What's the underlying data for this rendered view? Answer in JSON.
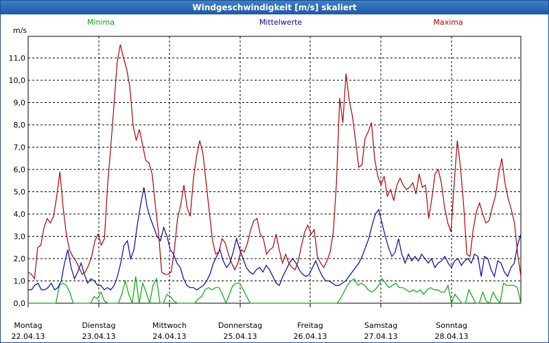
{
  "window": {
    "title": "Windgeschwindigkeit [m/s] skaliert"
  },
  "chart_data": {
    "type": "line",
    "title": "Windgeschwindigkeit [m/s] skaliert",
    "ylabel": "m/s",
    "ylim": [
      0,
      12
    ],
    "y_ticks": [
      "0,0",
      "1,0",
      "2,0",
      "3,0",
      "4,0",
      "5,0",
      "6,0",
      "7,0",
      "8,0",
      "9,0",
      "10,0",
      "11,0"
    ],
    "grid": true,
    "legend_position": "top",
    "days": [
      {
        "name": "Montag",
        "date": "22.04.13"
      },
      {
        "name": "Dienstag",
        "date": "23.04.13"
      },
      {
        "name": "Mittwoch",
        "date": "24.04.13"
      },
      {
        "name": "Donnerstag",
        "date": "25.04.13"
      },
      {
        "name": "Freitag",
        "date": "26.04.13"
      },
      {
        "name": "Samstag",
        "date": "27.04.13"
      },
      {
        "name": "Sonntag",
        "date": "28.04.13"
      }
    ],
    "series": [
      {
        "name": "Minima",
        "color": "#00aa00",
        "values": [
          0,
          0,
          0,
          0,
          0,
          0,
          0,
          0,
          0,
          0.8,
          0.9,
          0.8,
          0.5,
          0,
          0,
          0,
          0,
          0,
          0,
          0.3,
          0.2,
          0.5,
          0.1,
          0,
          0,
          0,
          0,
          0.4,
          1,
          0.4,
          0,
          1.2,
          0,
          0.9,
          0.5,
          0,
          0.8,
          1.1,
          0,
          0,
          0.4,
          0.3,
          0.1,
          0,
          0,
          0,
          0,
          0,
          0,
          0.2,
          0.3,
          0.6,
          0.7,
          0.6,
          0.7,
          0.7,
          0.4,
          0,
          0.4,
          0.8,
          0.9,
          0.9,
          0.6,
          0.3,
          0,
          0,
          0,
          0,
          0,
          0,
          0,
          0,
          0,
          0,
          0,
          0,
          0,
          0,
          0,
          0,
          0,
          0,
          0,
          0,
          0,
          0,
          0,
          0,
          0,
          0,
          0.2,
          0.5,
          0.8,
          1,
          1.1,
          0.8,
          0.9,
          0.8,
          0.6,
          0.5,
          0.6,
          0.8,
          1.1,
          0.9,
          0.7,
          0.8,
          0.9,
          0.7,
          0.7,
          0.6,
          0.5,
          0.6,
          0.5,
          0.6,
          0.4,
          0.6,
          0.7,
          0.6,
          0.6,
          0.5,
          0.5,
          0.8,
          0,
          0.4,
          0.2,
          0,
          0,
          0.6,
          0.3,
          0,
          0,
          0.5,
          0.1,
          0,
          0.5,
          0.2,
          0,
          0.9,
          0.8,
          0.8,
          0.8,
          0.7,
          0
        ]
      },
      {
        "name": "Mittelwerte",
        "color": "#0000aa",
        "values": [
          0.6,
          0.6,
          0.8,
          0.9,
          0.6,
          0.6,
          0.7,
          0.9,
          0.6,
          0.7,
          1,
          1.8,
          2.4,
          1.6,
          1.1,
          1.4,
          1.8,
          1.3,
          0.9,
          1.1,
          1,
          0.8,
          0.8,
          0.6,
          0.7,
          0.6,
          0.8,
          1.2,
          1.8,
          2.6,
          2.8,
          2,
          2.4,
          3.5,
          4.4,
          5.2,
          4.3,
          3.8,
          3.4,
          3,
          2.8,
          3.4,
          3,
          2.4,
          2.2,
          1.8,
          1.6,
          1.1,
          0.8,
          0.7,
          0.7,
          0.6,
          0.7,
          0.8,
          1,
          1.3,
          1.8,
          2.1,
          2.4,
          1.9,
          1.6,
          1.8,
          2.3,
          2.9,
          2.4,
          2,
          1.6,
          1.4,
          1.3,
          1.5,
          1.6,
          1.4,
          1.7,
          1.5,
          1.2,
          0.9,
          0.8,
          1.2,
          1.5,
          1.8,
          2,
          1.8,
          1.5,
          1.3,
          1.2,
          1.3,
          1.6,
          1.9,
          1.5,
          1.2,
          1,
          1,
          0.9,
          0.8,
          0.8,
          0.9,
          1,
          1.2,
          1.4,
          1.6,
          1.8,
          2.1,
          2.5,
          2.9,
          3.5,
          4,
          4.2,
          3.6,
          3,
          2.5,
          2.1,
          2.3,
          2.9,
          2.2,
          1.8,
          2.2,
          1.9,
          2.1,
          1.9,
          2.2,
          2,
          1.8,
          2,
          1.6,
          1.8,
          1.9,
          2.1,
          1.8,
          1.6,
          1.9,
          2,
          1.7,
          1.9,
          2,
          1.8,
          2.2,
          2.1,
          1.2,
          2.1,
          2,
          1.5,
          1.2,
          1.9,
          1.8,
          1.4,
          1.2,
          1.6,
          1.8,
          2.6,
          3.1
        ]
      },
      {
        "name": "Maxima",
        "color": "#aa0000",
        "values": [
          1.4,
          1.3,
          1.1,
          2.5,
          2.6,
          3.4,
          3.8,
          3.6,
          3.9,
          4.8,
          5.9,
          4.3,
          3.1,
          2.4,
          2.1,
          1.9,
          1.6,
          1.3,
          1.4,
          1.7,
          2.1,
          2.8,
          3.1,
          2.6,
          2.9,
          5.3,
          7,
          8.9,
          10.8,
          11.6,
          11,
          10.5,
          9.7,
          8,
          7.3,
          7.8,
          7.1,
          6.4,
          6.3,
          5.8,
          4.4,
          3.2,
          1.4,
          1.3,
          1.3,
          1.4,
          2.4,
          3.8,
          4.4,
          5.3,
          4.3,
          3.9,
          5.6,
          6.6,
          7.3,
          6.7,
          5.4,
          4.1,
          2.8,
          2.2,
          2.3,
          2.9,
          2.7,
          2.2,
          1.8,
          1.5,
          1.8,
          2.4,
          2.3,
          2.7,
          3.3,
          3.7,
          3.8,
          3.1,
          2.9,
          2.2,
          2.4,
          2.5,
          3.1,
          2.4,
          1.8,
          2.2,
          1.8,
          1.6,
          1.5,
          1.9,
          2.6,
          3.2,
          3.5,
          3.1,
          3.3,
          2.1,
          1.8,
          1.6,
          1.9,
          2.3,
          3.2,
          5.4,
          9.2,
          8.1,
          10.3,
          9.1,
          8.4,
          7.3,
          6.1,
          6.2,
          7.4,
          7.7,
          8.1,
          6.5,
          5.7,
          5.3,
          5.7,
          4.8,
          5.1,
          4.6,
          5.3,
          5.6,
          5.3,
          5.1,
          5.2,
          5.4,
          4.9,
          5.8,
          5.2,
          5.3,
          3.8,
          4.7,
          5.8,
          6,
          5.4,
          4.3,
          3.6,
          3.2,
          5.3,
          7.3,
          6.1,
          4.4,
          2.2,
          2.1,
          3.3,
          4.1,
          4.5,
          4,
          3.6,
          3.7,
          4.3,
          4.8,
          5.8,
          6.5,
          5.4,
          4.7,
          4.2,
          3.6,
          2.2,
          1.2
        ]
      }
    ]
  }
}
